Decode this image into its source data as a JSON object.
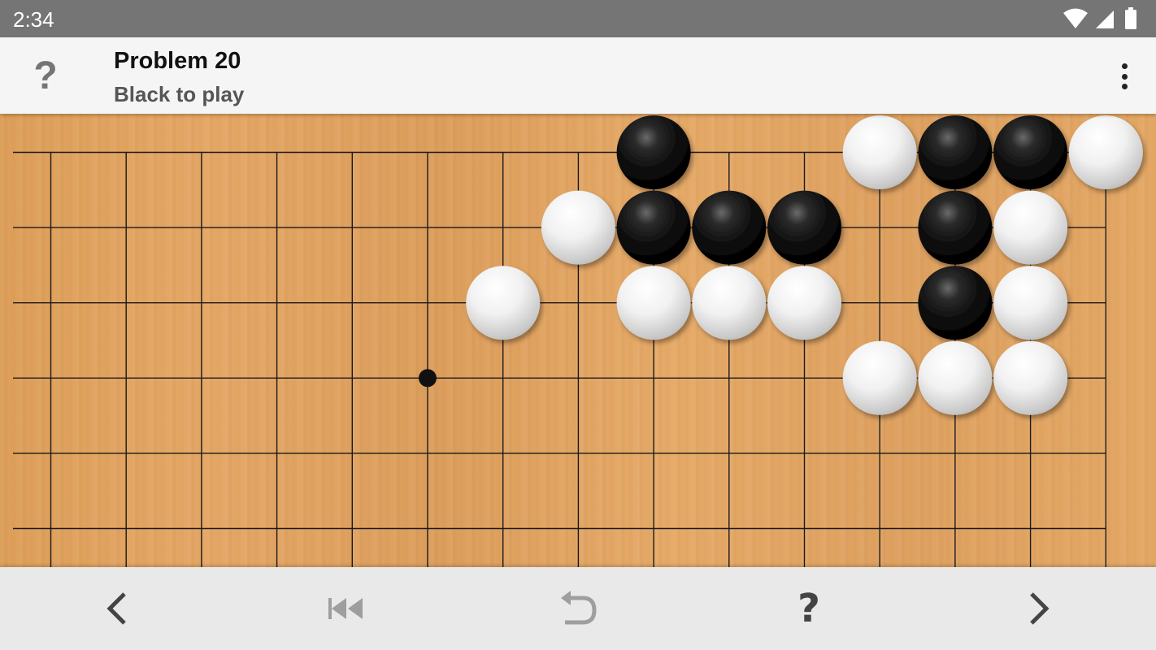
{
  "status_bar": {
    "time": "2:34",
    "icons": [
      "wifi-icon",
      "cell-signal-icon",
      "battery-icon"
    ]
  },
  "app_bar": {
    "help_icon": "?",
    "title": "Problem 20",
    "subtitle": "Black to play",
    "menu_icon": "overflow-menu-icon"
  },
  "board": {
    "visible_columns": 15,
    "visible_rows": 6,
    "star_points": [
      [
        5,
        3
      ]
    ],
    "stones": [
      {
        "color": "black",
        "col": 8,
        "row": 0
      },
      {
        "color": "white",
        "col": 11,
        "row": 0
      },
      {
        "color": "black",
        "col": 12,
        "row": 0
      },
      {
        "color": "black",
        "col": 13,
        "row": 0
      },
      {
        "color": "white",
        "col": 14,
        "row": 0
      },
      {
        "color": "white",
        "col": 7,
        "row": 1
      },
      {
        "color": "black",
        "col": 8,
        "row": 1
      },
      {
        "color": "black",
        "col": 9,
        "row": 1
      },
      {
        "color": "black",
        "col": 10,
        "row": 1
      },
      {
        "color": "black",
        "col": 12,
        "row": 1
      },
      {
        "color": "white",
        "col": 13,
        "row": 1
      },
      {
        "color": "white",
        "col": 6,
        "row": 2
      },
      {
        "color": "white",
        "col": 8,
        "row": 2
      },
      {
        "color": "white",
        "col": 9,
        "row": 2
      },
      {
        "color": "white",
        "col": 10,
        "row": 2
      },
      {
        "color": "black",
        "col": 12,
        "row": 2
      },
      {
        "color": "white",
        "col": 13,
        "row": 2
      },
      {
        "color": "white",
        "col": 11,
        "row": 3
      },
      {
        "color": "white",
        "col": 12,
        "row": 3
      },
      {
        "color": "white",
        "col": 13,
        "row": 3
      }
    ]
  },
  "bottom_nav": {
    "previous": "chevron-left-icon",
    "first": "skip-to-start-icon",
    "undo": "undo-icon",
    "hint": "?",
    "next": "chevron-right-icon"
  },
  "colors": {
    "status_bar": "#757575",
    "app_bar": "#f5f5f5",
    "board_wood": "#e2a463",
    "grid_line": "#1a1a1a",
    "nav_enabled": "#444444",
    "nav_disabled": "#9e9e9e"
  }
}
